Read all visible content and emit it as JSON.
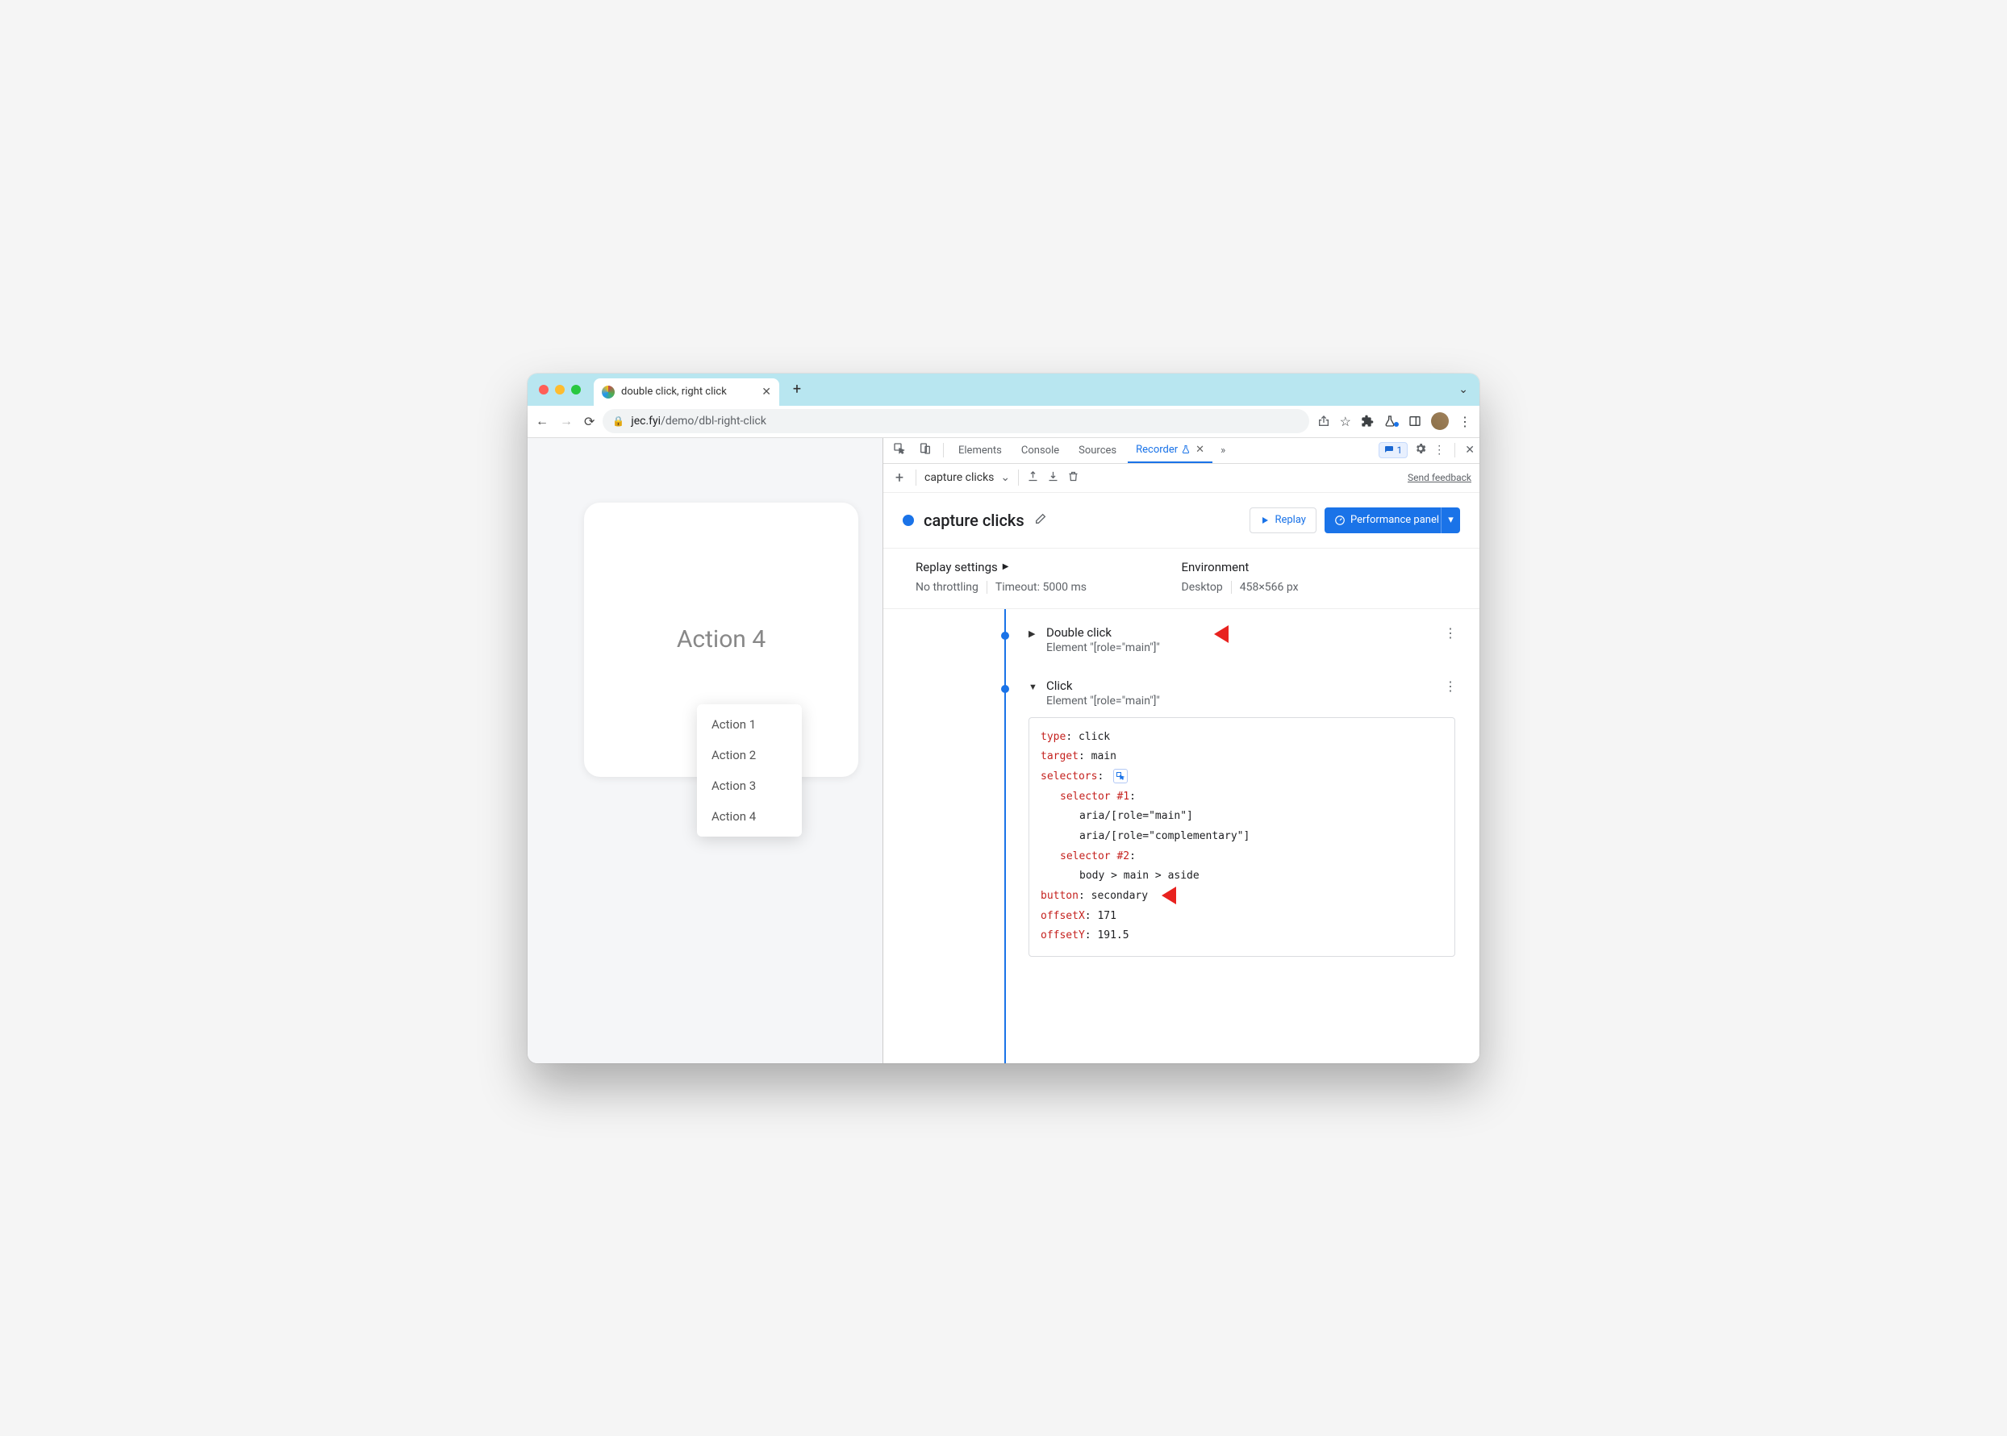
{
  "tab": {
    "title": "double click, right click"
  },
  "url": {
    "domain": "jec.fyi",
    "path": "/demo/dbl-right-click"
  },
  "page": {
    "card_title": "Action 4",
    "menu": [
      "Action 1",
      "Action 2",
      "Action 3",
      "Action 4"
    ]
  },
  "devtools": {
    "tabs": [
      "Elements",
      "Console",
      "Sources",
      "Recorder"
    ],
    "active_tab": "Recorder",
    "issues_count": "1"
  },
  "recorder": {
    "toolbar_name": "capture clicks",
    "feedback": "Send feedback",
    "title": "capture clicks",
    "replay_btn": "Replay",
    "perf_btn": "Performance panel",
    "settings_heading": "Replay settings",
    "throttling": "No throttling",
    "timeout": "Timeout: 5000 ms",
    "env_heading": "Environment",
    "env_device": "Desktop",
    "env_size": "458×566 px"
  },
  "steps": [
    {
      "label": "Double click",
      "sub": "Element \"[role=\"main\"]\"",
      "expanded": false
    },
    {
      "label": "Click",
      "sub": "Element \"[role=\"main\"]\"",
      "expanded": true,
      "details": {
        "type": "click",
        "target": "main",
        "selectors_label": "selectors",
        "sel1_label": "selector #1",
        "sel1_a": "aria/[role=\"main\"]",
        "sel1_b": "aria/[role=\"complementary\"]",
        "sel2_label": "selector #2",
        "sel2_a": "body > main > aside",
        "button": "secondary",
        "offsetX": "171",
        "offsetY": "191.5"
      }
    }
  ]
}
